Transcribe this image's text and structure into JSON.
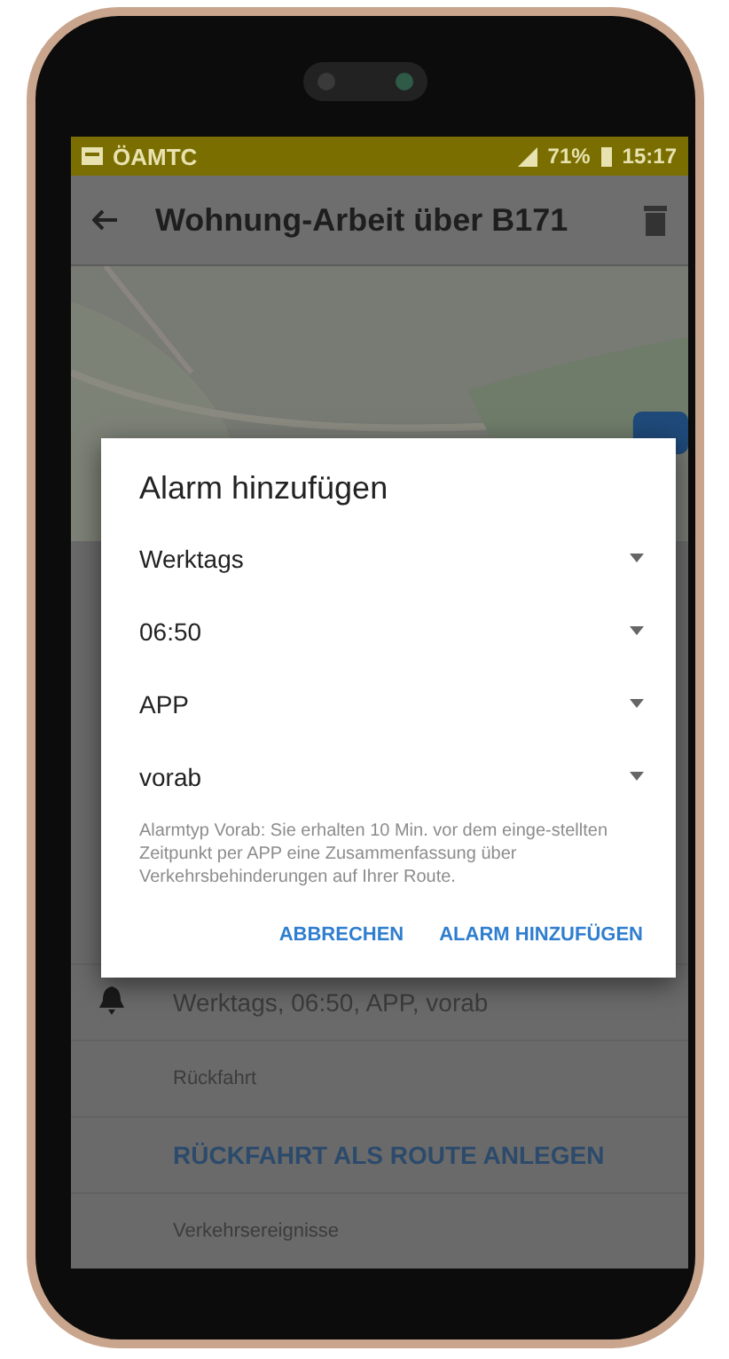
{
  "status_bar": {
    "app_name": "ÖAMTC",
    "battery": "71%",
    "time": "15:17"
  },
  "app_bar": {
    "title": "Wohnung-Arbeit über B171"
  },
  "list": [
    {
      "kind": "alarm",
      "text": "Werktags, 06:50, APP, vorab"
    },
    {
      "kind": "header",
      "text": "Rückfahrt"
    },
    {
      "kind": "action",
      "text": "RÜCKFAHRT ALS ROUTE ANLEGEN"
    },
    {
      "kind": "header",
      "text": "Verkehrsereignisse"
    }
  ],
  "dialog": {
    "title": "Alarm hinzufügen",
    "dropdowns": [
      {
        "value": "Werktags"
      },
      {
        "value": "06:50"
      },
      {
        "value": "APP"
      },
      {
        "value": "vorab"
      }
    ],
    "hint": "Alarmtyp Vorab: Sie erhalten 10 Min. vor dem einge-stellten Zeitpunkt per APP eine Zusammenfassung über Verkehrsbehinderungen auf Ihrer Route.",
    "buttons": [
      "ABBRECHEN",
      "ALARM HINZUFÜGEN"
    ]
  }
}
